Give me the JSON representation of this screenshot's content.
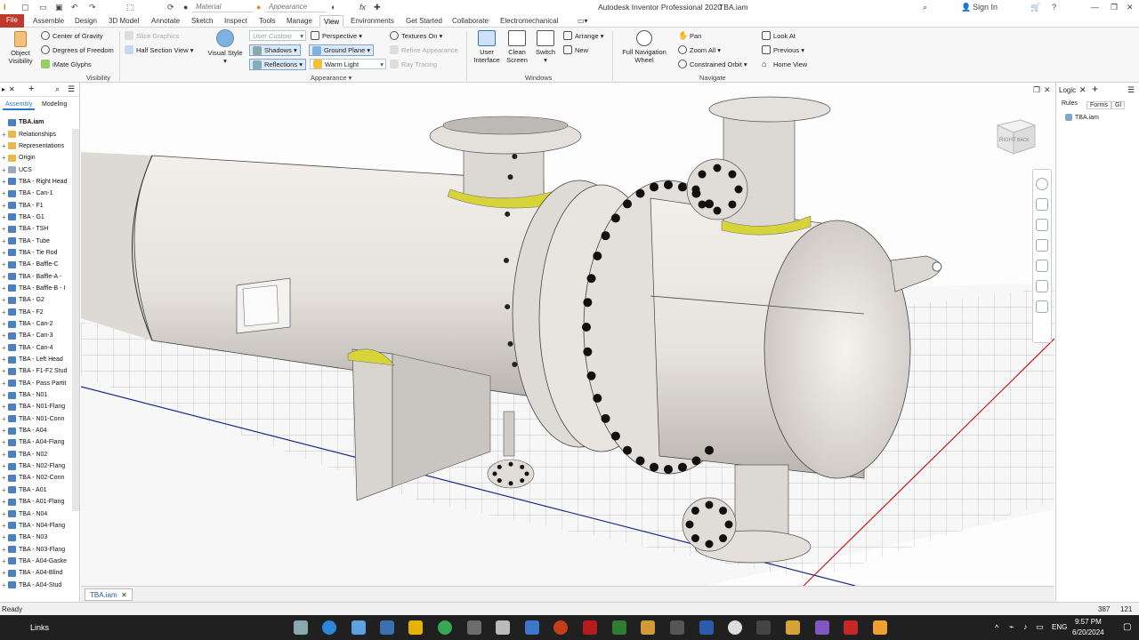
{
  "titlebar": {
    "material_placeholder": "Material",
    "appearance_placeholder": "Appearance",
    "app_title": "Autodesk Inventor Professional 2020",
    "doc_title": "TBA.iam",
    "sign_in": "Sign In"
  },
  "tabs": [
    "File",
    "Assemble",
    "Design",
    "3D Model",
    "Annotate",
    "Sketch",
    "Inspect",
    "Tools",
    "Manage",
    "View",
    "Environments",
    "Get Started",
    "Collaborate",
    "Electromechanical"
  ],
  "active_tab": "View",
  "ribbon": {
    "visibility": {
      "object_visibility": "Object Visibility",
      "center_of_gravity": "Center of Gravity",
      "degrees_of_freedom": "Degrees of Freedom",
      "imate_glyphs": "iMate Glyphs",
      "group": "Visibility"
    },
    "appearance": {
      "slice_graphics": "Slice Graphics",
      "half_section_view": "Half Section View",
      "visual_style": "Visual Style",
      "user_custom": "User Custom",
      "shadows": "Shadows",
      "reflections": "Reflections",
      "perspective": "Perspective",
      "ground_plane": "Ground Plane",
      "warm_light": "Warm Light",
      "textures_on": "Textures On",
      "refine_appearance": "Refine Appearance",
      "ray_tracing": "Ray Tracing",
      "group": "Appearance"
    },
    "windows": {
      "user_interface": "User Interface",
      "clean_screen": "Clean Screen",
      "switch": "Switch",
      "arrange": "Arrange",
      "new": "New",
      "group": "Windows"
    },
    "navigate": {
      "full_navigation_wheel": "Full Navigation Wheel",
      "pan": "Pan",
      "zoom_all": "Zoom All",
      "constrained_orbit": "Constrained Orbit",
      "look_at": "Look At",
      "previous": "Previous",
      "home_view": "Home View",
      "group": "Navigate"
    }
  },
  "browser": {
    "tabs": [
      "Assembly",
      "Modeling"
    ],
    "root": "TBA.iam",
    "items": [
      "Relationships",
      "Representations",
      "Origin",
      "UCS",
      "TBA - Right Head",
      "TBA - Can-1",
      "TBA - F1",
      "TBA - G1",
      "TBA - TSH",
      "TBA - Tube",
      "TBA - Tie Rod",
      "TBA - Baffle-C",
      "TBA - Baffle-A -",
      "TBA - Baffle-B - I",
      "TBA - G2",
      "TBA - F2",
      "TBA - Can-2",
      "TBA - Can-3",
      "TBA - Can-4",
      "TBA - Left Head",
      "TBA - F1-F2 Stud",
      "TBA - Pass Partit",
      "TBA - N01",
      "TBA - N01-Flang",
      "TBA - N01-Conn",
      "TBA - A04",
      "TBA - A04-Flang",
      "TBA - N02",
      "TBA - N02-Flang",
      "TBA - N02-Conn",
      "TBA - A01",
      "TBA - A01-Flang",
      "TBA - N04",
      "TBA - N04-Flang",
      "TBA - N03",
      "TBA - N03-Flang",
      "TBA - A04-Gaske",
      "TBA - A04-Blind",
      "TBA - A04-Stud"
    ]
  },
  "viewcube": {
    "face_right": "RIGHT",
    "face_back": "BACK"
  },
  "document_tab": "TBA.iam",
  "ilogic": {
    "title": "Logic",
    "tabs": [
      "Rules",
      "Forms",
      "Gl"
    ],
    "item": "TBA.iam"
  },
  "status": {
    "text": "Ready",
    "x": "387",
    "y": "121"
  },
  "taskbar": {
    "links": "Links",
    "lang": "ENG",
    "time": "9:57 PM",
    "date": "6/20/2024"
  },
  "colors": {
    "file_tab": "#c0392b",
    "active_tab_border": "#c9c9c9",
    "taskbar": "#202020",
    "vessel": "#e8e4df",
    "saddle_yellow": "#d7d43a"
  }
}
